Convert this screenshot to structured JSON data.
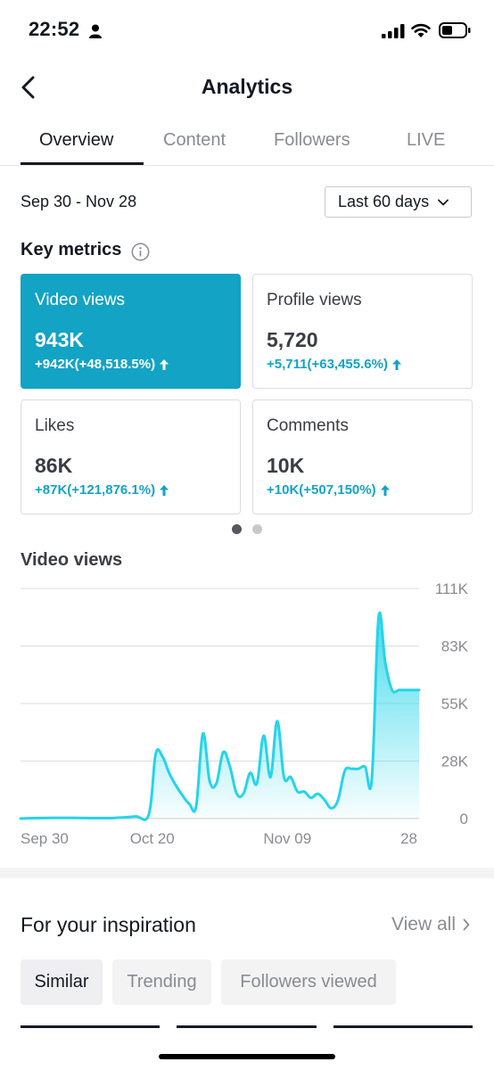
{
  "status_bar": {
    "time": "22:52"
  },
  "header": {
    "title": "Analytics"
  },
  "tabs": [
    {
      "label": "Overview",
      "active": true
    },
    {
      "label": "Content",
      "active": false
    },
    {
      "label": "Followers",
      "active": false
    },
    {
      "label": "LIVE",
      "active": false
    }
  ],
  "date_range": "Sep 30 - Nov 28",
  "range_select": {
    "value": "Last 60 days"
  },
  "key_metrics": {
    "title": "Key metrics",
    "cards": [
      {
        "label": "Video views",
        "value": "943K",
        "delta": "+942K(+48,518.5%)",
        "selected": true
      },
      {
        "label": "Profile views",
        "value": "5,720",
        "delta": "+5,711(+63,455.6%)",
        "selected": false
      },
      {
        "label": "Likes",
        "value": "86K",
        "delta": "+87K(+121,876.1%)",
        "selected": false
      },
      {
        "label": "Comments",
        "value": "10K",
        "delta": "+10K(+507,150%)",
        "selected": false
      }
    ],
    "pager": {
      "pages": 2,
      "current": 1
    }
  },
  "colors": {
    "accent": "#13a3c4",
    "line": "#25d4ea",
    "text": "#161823",
    "muted": "#8a8b91"
  },
  "chart_data": {
    "type": "area",
    "title": "Video views",
    "x_ticks": [
      "Sep 30",
      "Oct 20",
      "Nov 09",
      "28"
    ],
    "y_ticks": [
      "0",
      "28K",
      "55K",
      "83K",
      "111K"
    ],
    "ylim": [
      0,
      111000
    ],
    "grid": true,
    "x": [
      1,
      3,
      6,
      9,
      12,
      15,
      18,
      20,
      21,
      22,
      23,
      24,
      25,
      26,
      27,
      28,
      29,
      30,
      31,
      32,
      33,
      34,
      35,
      36,
      37,
      38,
      39,
      40,
      41,
      42,
      43,
      44,
      45,
      46,
      47,
      48,
      49,
      50,
      51,
      52,
      53,
      54,
      55,
      56,
      57,
      58,
      59,
      60
    ],
    "values": [
      0,
      200,
      300,
      300,
      200,
      300,
      1000,
      2000,
      31000,
      30000,
      22000,
      16000,
      11000,
      7000,
      6000,
      41000,
      18000,
      17000,
      32000,
      25000,
      12000,
      12000,
      22000,
      17000,
      40000,
      20000,
      47000,
      20000,
      20000,
      13000,
      13000,
      10000,
      12000,
      9000,
      5000,
      9000,
      23000,
      24000,
      24000,
      25000,
      19000,
      97000,
      75000,
      62000,
      62000,
      62000,
      62000,
      62000
    ]
  },
  "inspiration": {
    "title": "For your inspiration",
    "view_all": "View all",
    "chips": [
      {
        "label": "Similar",
        "active": true
      },
      {
        "label": "Trending",
        "active": false
      },
      {
        "label": "Followers viewed",
        "active": false
      }
    ]
  }
}
